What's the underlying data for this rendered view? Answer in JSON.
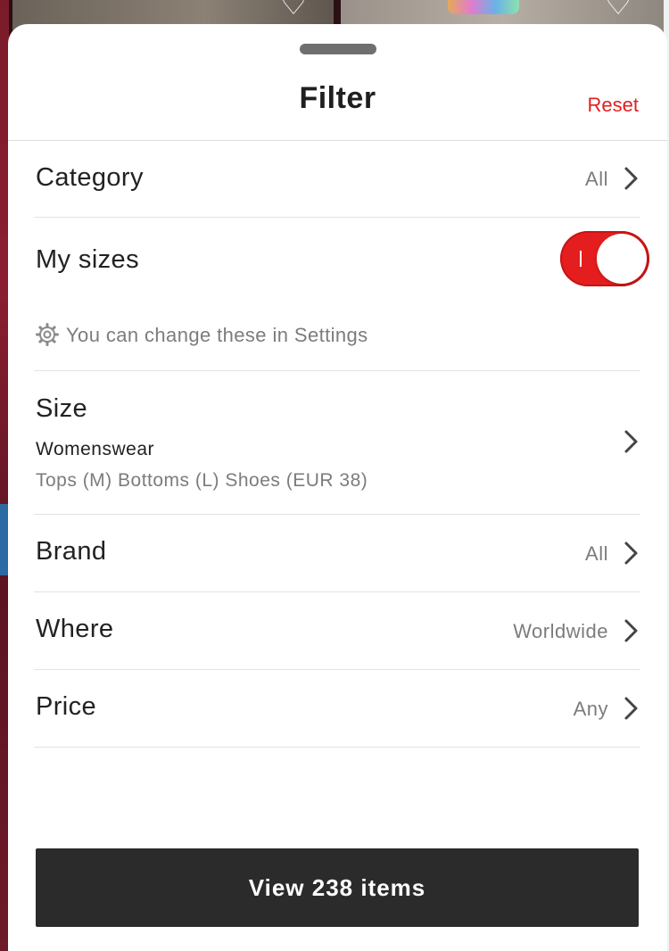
{
  "sheet": {
    "title": "Filter",
    "reset_label": "Reset"
  },
  "filters": {
    "category": {
      "label": "Category",
      "value": "All"
    },
    "my_sizes": {
      "label": "My sizes",
      "enabled": true,
      "hint": "You can change these in Settings"
    },
    "size": {
      "label": "Size",
      "group": "Womenswear",
      "details": "Tops (M) Bottoms (L) Shoes (EUR 38)"
    },
    "brand": {
      "label": "Brand",
      "value": "All"
    },
    "where": {
      "label": "Where",
      "value": "Worldwide"
    },
    "price": {
      "label": "Price",
      "value": "Any"
    }
  },
  "cta": {
    "label": "View 238 items"
  },
  "colors": {
    "accent": "#e41e1e",
    "reset": "#e0201f",
    "button_bg": "#2b2b2b"
  },
  "icons": {
    "chevron": "chevron-right-icon",
    "settings": "gear-icon",
    "heart": "heart-icon"
  }
}
